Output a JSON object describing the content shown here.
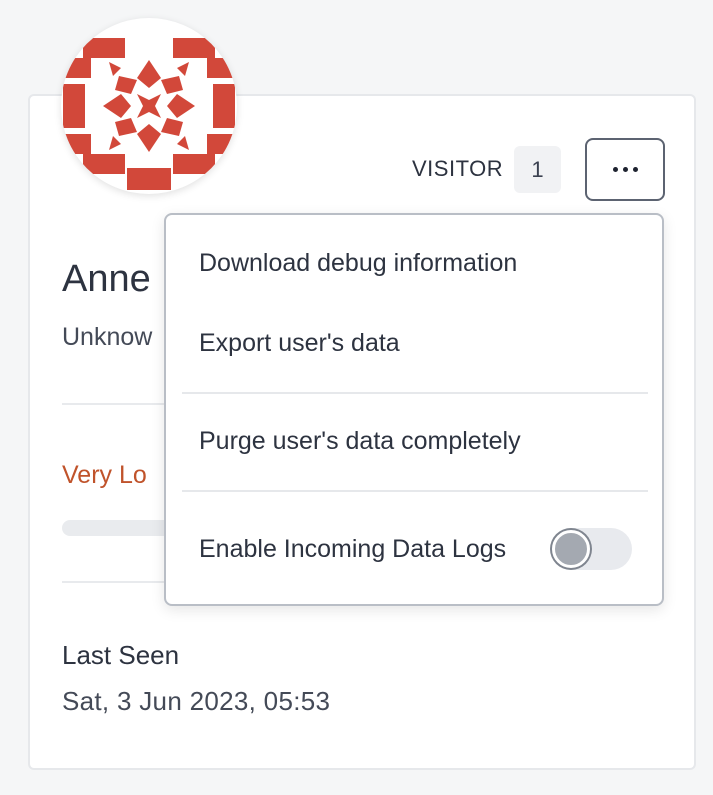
{
  "profile": {
    "name": "Anne",
    "location": "Unknow",
    "score_label": "Very Lo",
    "role_label": "VISITOR",
    "role_count": "1",
    "last_seen_label": "Last Seen",
    "last_seen_value": "Sat, 3 Jun 2023, 05:53"
  },
  "menu": {
    "items": [
      {
        "label": "Download debug information"
      },
      {
        "label": "Export user's data"
      },
      {
        "label": "Purge user's data completely"
      },
      {
        "label": "Enable Incoming Data Logs"
      }
    ],
    "toggle_enabled": false
  },
  "colors": {
    "avatar_pattern": "#d2483a",
    "score_text": "#c0532b"
  },
  "icons": {
    "more": "more-horizontal-icon",
    "avatar": "identicon"
  }
}
